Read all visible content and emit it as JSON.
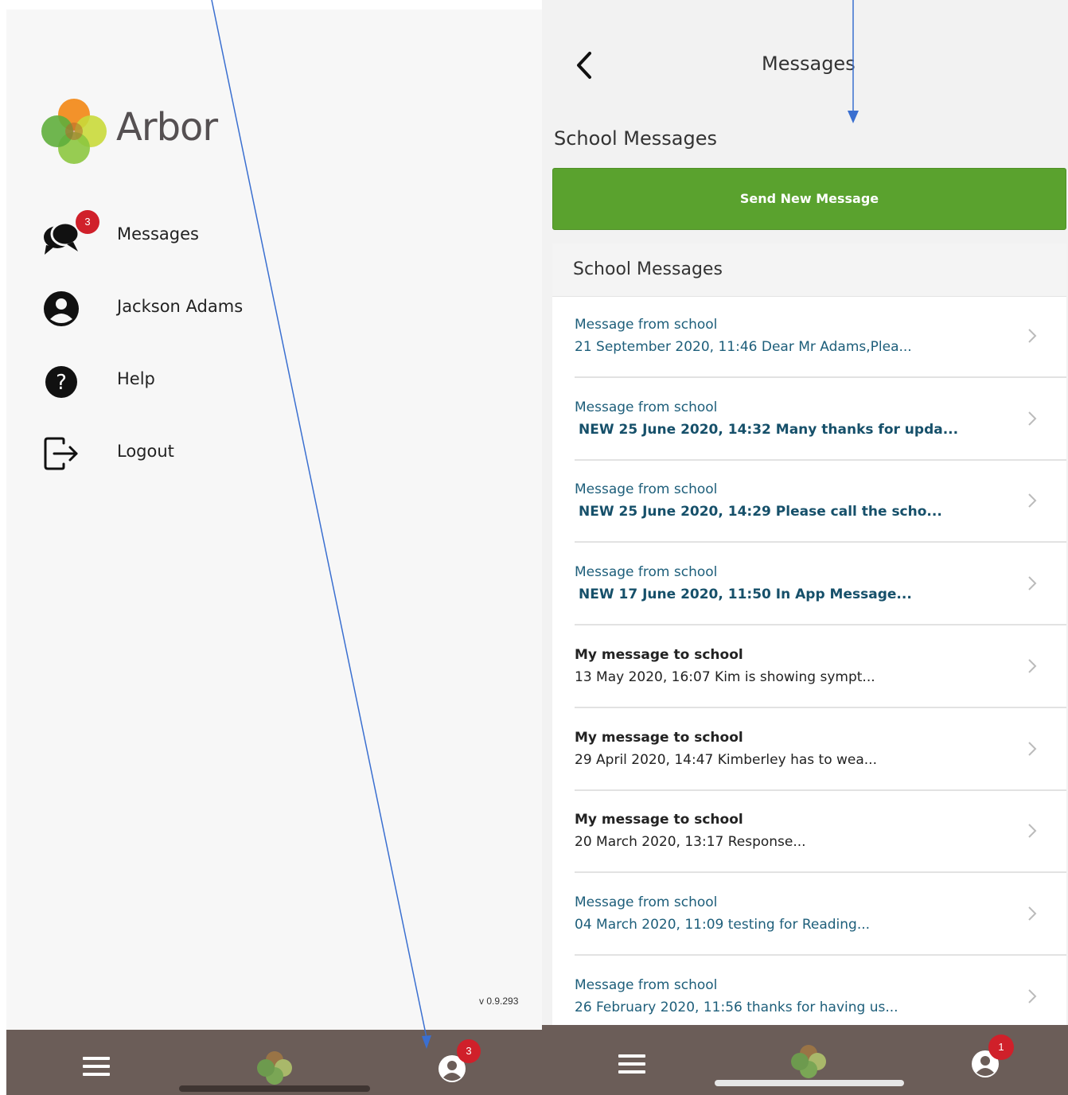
{
  "left_panel": {
    "brand": "Arbor",
    "menu": [
      {
        "label": "Messages",
        "icon": "chat-bubbles-icon",
        "badge": "3"
      },
      {
        "label": "Jackson Adams",
        "icon": "user-circle-icon"
      },
      {
        "label": "Help",
        "icon": "question-circle-icon"
      },
      {
        "label": "Logout",
        "icon": "logout-icon"
      }
    ],
    "version": "v 0.9.293"
  },
  "bottom_left": {
    "profile_badge": "3"
  },
  "bottom_right": {
    "profile_badge": "1"
  },
  "right_panel": {
    "page_title": "Messages",
    "section_title": "School Messages",
    "send_button": "Send New Message",
    "list_header": "School Messages",
    "messages": [
      {
        "title": "Message from school",
        "subtitle": "21 September 2020, 11:46 Dear Mr Adams,Plea..."
      },
      {
        "title": "Message from school",
        "subtitle": "NEW 25 June 2020, 14:32 Many thanks for upda..."
      },
      {
        "title": "Message from school",
        "subtitle": "NEW 25 June 2020, 14:29 Please call the scho..."
      },
      {
        "title": "Message from school",
        "subtitle": "NEW 17 June 2020, 11:50 In App Message..."
      },
      {
        "title": "My message to school",
        "subtitle": "13 May 2020, 16:07 Kim is showing sympt..."
      },
      {
        "title": "My message to school",
        "subtitle": "29 April 2020, 14:47 Kimberley has to wea..."
      },
      {
        "title": "My message to school",
        "subtitle": "20 March 2020, 13:17 Response..."
      },
      {
        "title": "Message from school",
        "subtitle": "04 March 2020, 11:09 testing for Reading..."
      },
      {
        "title": "Message from school",
        "subtitle": "26 February 2020, 11:56 thanks for having us..."
      }
    ]
  },
  "colors": {
    "accent_green": "#5aa22e",
    "badge_red": "#d0202a",
    "bar_brown": "#6b5d58",
    "link_teal": "#1d5e7a",
    "annotation_blue": "#3a6fd0"
  }
}
